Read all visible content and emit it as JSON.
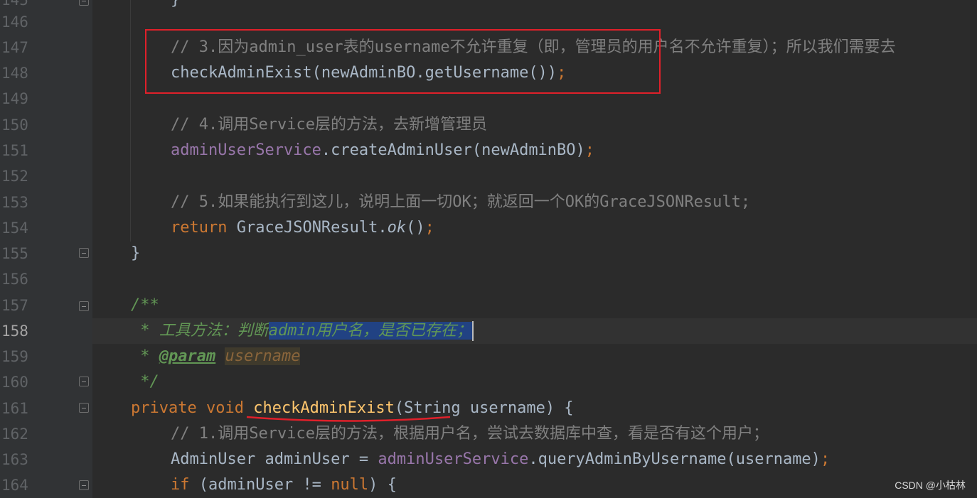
{
  "editor": {
    "colors": {
      "background": "#2b2b2b",
      "gutter": "#313335",
      "keyword": "#cc7832",
      "comment": "#808080",
      "doc_comment": "#629755",
      "field": "#9876aa",
      "method_decl": "#ffc66d",
      "selection": "#214283",
      "annotation_box": "#e0202a"
    },
    "line_numbers": [
      "145",
      "146",
      "147",
      "148",
      "149",
      "150",
      "151",
      "152",
      "153",
      "154",
      "155",
      "156",
      "157",
      "158",
      "159",
      "160",
      "161",
      "162",
      "163",
      "164"
    ],
    "current_line": "158",
    "lines": {
      "l145": "}",
      "l147_comment": "// 3.因为admin_user表的username不允许重复（即，管理员的用户名不允许重复）；所以我们需要去",
      "l148_call": "checkAdminExist(newAdminBO.getUsername())",
      "l148_semi": ";",
      "l150_comment": "// 4.调用Service层的方法，去新增管理员",
      "l151_field": "adminUserService",
      "l151_rest": ".createAdminUser(newAdminBO)",
      "l151_semi": ";",
      "l153_comment": "// 5.如果能执行到这儿，说明上面一切OK；就返回一个OK的GraceJSONResult;",
      "l154_return": "return",
      "l154_class": " GraceJSONResult.",
      "l154_method": "ok",
      "l154_parens": "()",
      "l154_semi": ";",
      "l155": "}",
      "l157": "/**",
      "l158_prefix": " * 工具方法：判断",
      "l158_selected": "admin用户名，是否已存在；",
      "l159_star": " * ",
      "l159_tag": "@param",
      "l159_space": " ",
      "l159_param": "username",
      "l160": " */",
      "l161_private": "private",
      "l161_void": " void",
      "l161_space": " ",
      "l161_method": "checkAdminExist",
      "l161_rest": "(String username) {",
      "l162_comment": "// 1.调用Service层的方法，根据用户名，尝试去数据库中查，看是否有这个用户；",
      "l163_decl": "AdminUser adminUser = ",
      "l163_field": "adminUserService",
      "l163_rest": ".queryAdminByUsername(username)",
      "l163_semi": ";",
      "l164_if": "if",
      "l164_rest": " (adminUser != ",
      "l164_null": "null",
      "l164_end": ") {"
    }
  },
  "watermark": "CSDN @小枯林"
}
